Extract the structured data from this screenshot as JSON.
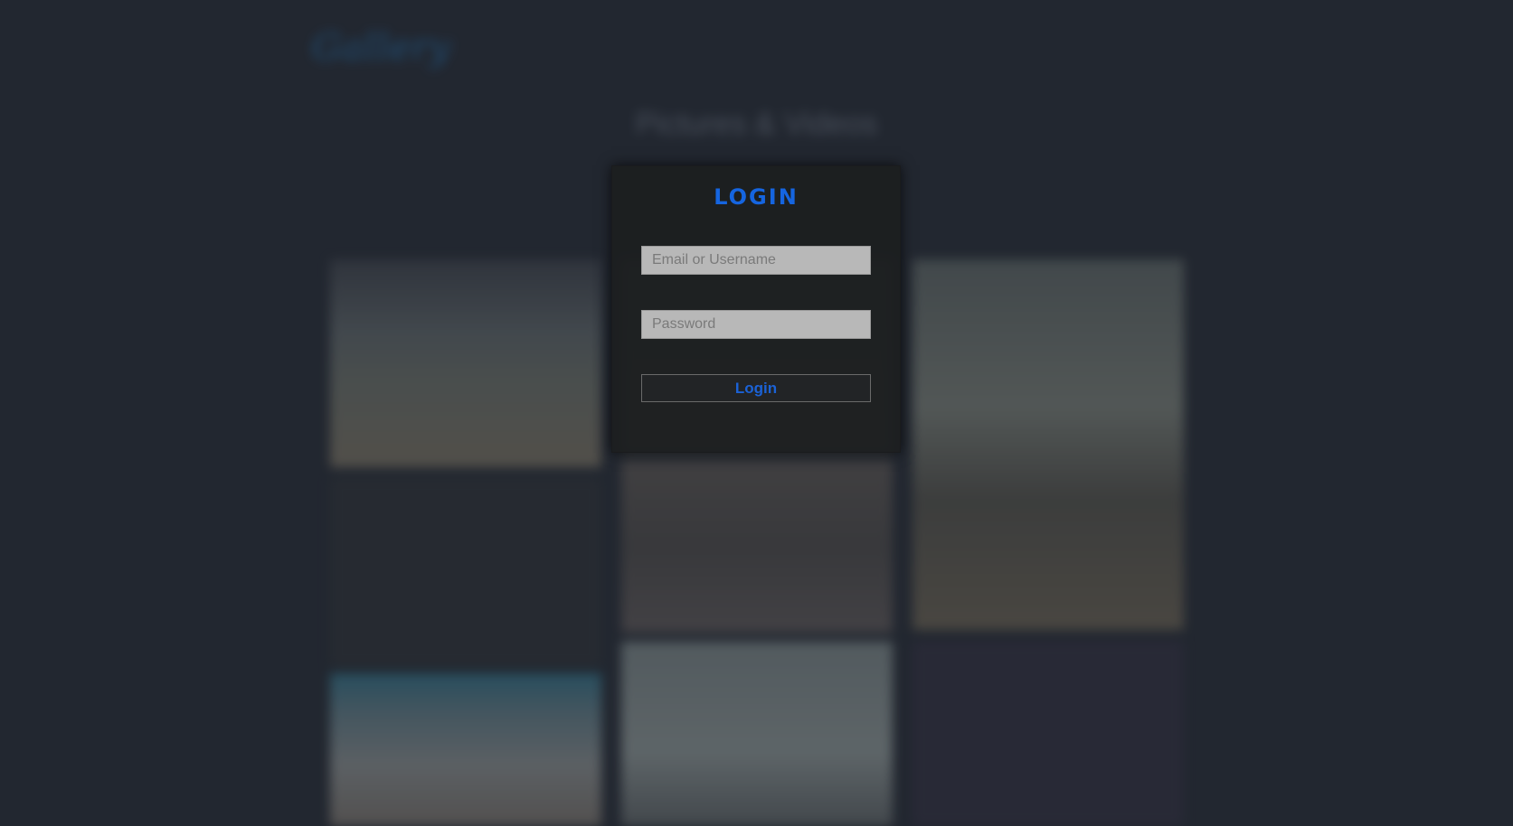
{
  "header": {
    "logo_text": "Gallery"
  },
  "gallery": {
    "title": "Pictures & Videos"
  },
  "login_modal": {
    "title": "LOGIN",
    "email_placeholder": "Email or Username",
    "password_placeholder": "Password",
    "submit_label": "Login"
  },
  "colors": {
    "accent": "#1565e0",
    "background": "#222730",
    "modal_background": "#1c1e20",
    "input_background": "#b8b8b8"
  }
}
